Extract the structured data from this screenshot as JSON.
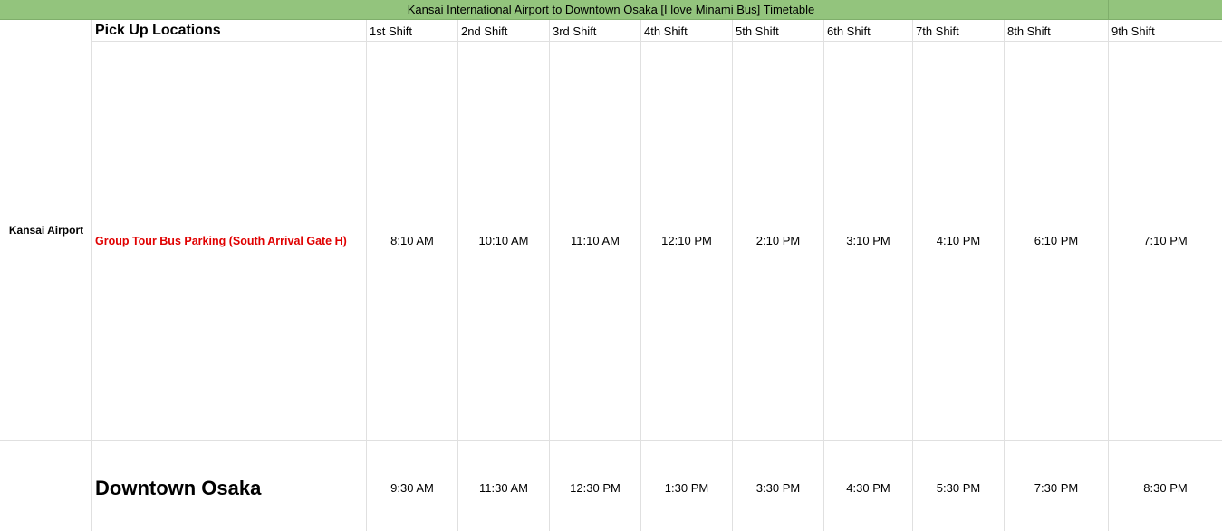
{
  "title": "Kansai International Airport to Downtown Osaka  [I love Minami Bus] Timetable",
  "pickup_header": "Pick Up Locations",
  "shifts": [
    "1st Shift",
    "2nd Shift",
    "3rd Shift",
    "4th Shift",
    "5th Shift",
    "6th Shift",
    "7th Shift",
    "8th Shift",
    "9th Shift"
  ],
  "rows": [
    {
      "origin": "Kansai Airport",
      "location": "Group Tour Bus Parking (South Arrival Gate H)",
      "location_color": "#e00000",
      "times": [
        "8:10 AM",
        "10:10 AM",
        "11:10 AM",
        "12:10 PM",
        "2:10 PM",
        "3:10 PM",
        "4:10 PM",
        "6:10 PM",
        "7:10 PM"
      ]
    },
    {
      "origin": "",
      "location": "Downtown Osaka",
      "times": [
        "9:30 AM",
        "11:30 AM",
        "12:30 PM",
        "1:30 PM",
        "3:30 PM",
        "4:30 PM",
        "5:30 PM",
        "7:30 PM",
        "8:30 PM"
      ]
    }
  ],
  "colors": {
    "banner": "#93c47d",
    "pickup_text": "#e00000",
    "grid": "#e0e0e0"
  }
}
